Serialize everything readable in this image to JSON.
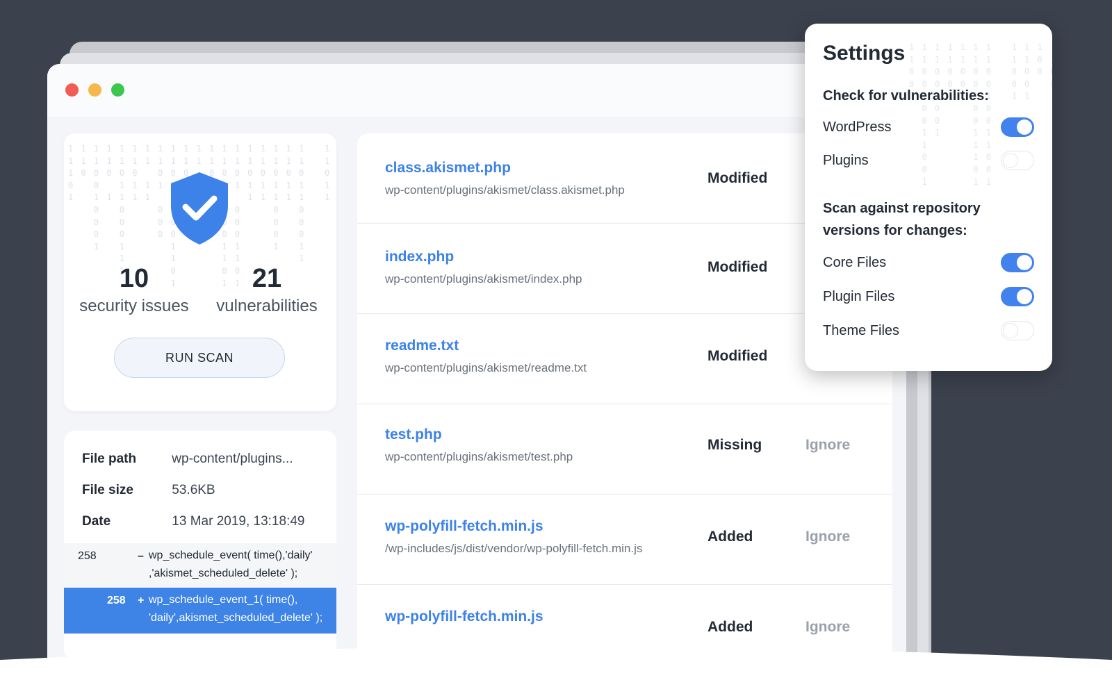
{
  "scan": {
    "security_issues_count": "10",
    "security_issues_label": "security issues",
    "vulnerabilities_count": "21",
    "vulnerabilities_label": "vulnerabilities",
    "run_scan_label": "RUN SCAN"
  },
  "file_detail": {
    "path_label": "File path",
    "path_value": "wp-content/plugins...",
    "size_label": "File size",
    "size_value": "53.6KB",
    "date_label": "Date",
    "date_value": "13 Mar 2019, 13:18:49",
    "diff": [
      {
        "line": "258",
        "sign": "–",
        "code": "wp_schedule_event( time(),'daily' ,'akismet_scheduled_delete' );"
      },
      {
        "line": "258",
        "sign": "+",
        "code": "wp_schedule_event_1( time(), 'daily',akismet_scheduled_delete' );"
      }
    ]
  },
  "files": [
    {
      "name": "class.akismet.php",
      "path": "wp-content/plugins/akismet/class.akismet.php",
      "status": "Modified",
      "action": ""
    },
    {
      "name": "index.php",
      "path": "wp-content/plugins/akismet/index.php",
      "status": "Modified",
      "action": ""
    },
    {
      "name": "readme.txt",
      "path": "wp-content/plugins/akismet/readme.txt",
      "status": "Modified",
      "action": ""
    },
    {
      "name": "test.php",
      "path": "wp-content/plugins/akismet/test.php",
      "status": "Missing",
      "action": "Ignore"
    },
    {
      "name": "wp-polyfill-fetch.min.js",
      "path": "/wp-includes/js/dist/vendor/wp-polyfill-fetch.min.js",
      "status": "Added",
      "action": "Ignore"
    },
    {
      "name": "wp-polyfill-fetch.min.js",
      "path": "",
      "status": "Added",
      "action": "Ignore"
    }
  ],
  "settings": {
    "title": "Settings",
    "vuln_heading": "Check for vulnerabilities:",
    "vuln_items": [
      {
        "label": "WordPress",
        "on": true
      },
      {
        "label": "Plugins",
        "on": false
      }
    ],
    "repo_heading": "Scan against repository versions for changes:",
    "repo_items": [
      {
        "label": "Core Files",
        "on": true
      },
      {
        "label": "Plugin Files",
        "on": true
      },
      {
        "label": "Theme Files",
        "on": false
      }
    ]
  },
  "colors": {
    "background": "#3b414d",
    "accent": "#3c82e8",
    "toggle_on": "#4282ee",
    "diff_highlight": "#3e83e6"
  }
}
